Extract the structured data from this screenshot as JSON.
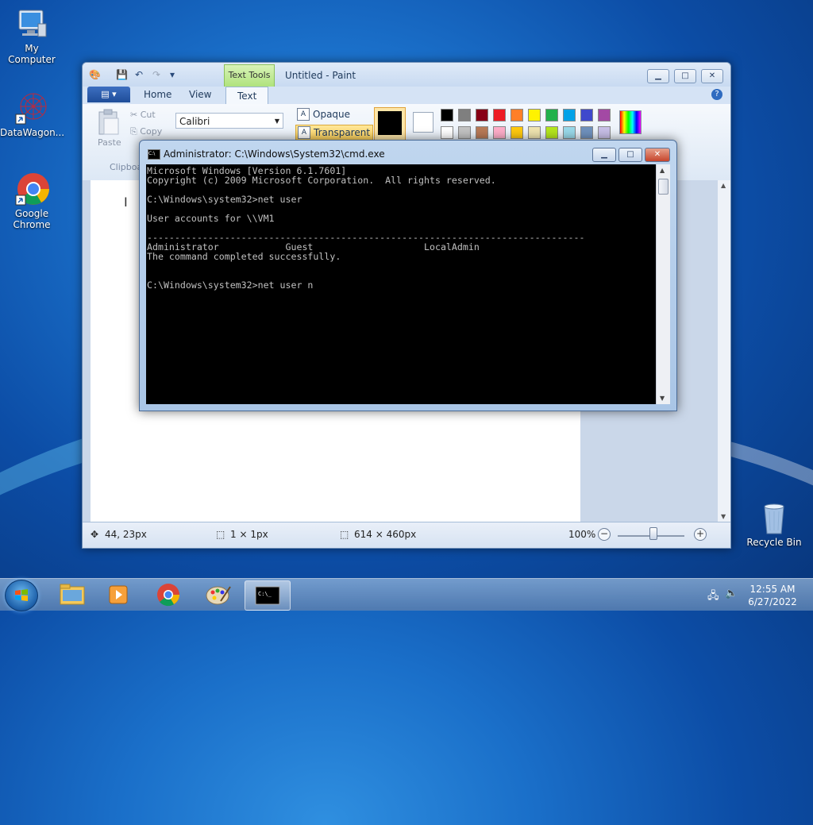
{
  "desktop": {
    "icons": [
      {
        "label": "My Computer"
      },
      {
        "label": "DataWagon..."
      },
      {
        "label": "Google Chrome"
      },
      {
        "label": "Recycle Bin"
      }
    ]
  },
  "paint": {
    "title": "Untitled - Paint",
    "context_tab": "Text Tools",
    "tabs": [
      "Home",
      "View",
      "Text"
    ],
    "active_tab": "Text",
    "clipboard": {
      "paste": "Paste",
      "cut": "Cut",
      "copy": "Copy",
      "group": "Clipboa"
    },
    "font_name": "Calibri",
    "background_options": [
      "Opaque",
      "Transparent"
    ],
    "selected_background": "Transparent",
    "palette_row1": [
      "#000000",
      "#7f7f7f",
      "#880015",
      "#ed1c24",
      "#ff7f27",
      "#fff200",
      "#22b14c",
      "#00a2e8",
      "#3f48cc",
      "#a349a4"
    ],
    "palette_row2": [
      "#ffffff",
      "#c3c3c3",
      "#b97a57",
      "#ffaec9",
      "#ffc90e",
      "#efe4b0",
      "#b5e61d",
      "#99d9ea",
      "#7092be",
      "#c8bfe7"
    ],
    "status": {
      "cursor_pos": "44, 23px",
      "selection_size": "1 × 1px",
      "canvas_size": "614 × 460px",
      "zoom": "100%"
    }
  },
  "cmd": {
    "title": "Administrator: C:\\Windows\\System32\\cmd.exe",
    "lines": [
      "Microsoft Windows [Version 6.1.7601]",
      "Copyright (c) 2009 Microsoft Corporation.  All rights reserved.",
      "",
      "C:\\Windows\\system32>net user",
      "",
      "User accounts for \\\\VM1",
      "",
      "-------------------------------------------------------------------------------",
      "Administrator            Guest                    LocalAdmin",
      "The command completed successfully.",
      "",
      "",
      "C:\\Windows\\system32>net user n"
    ]
  },
  "taskbar": {
    "time": "12:55 AM",
    "date": "6/27/2022"
  }
}
